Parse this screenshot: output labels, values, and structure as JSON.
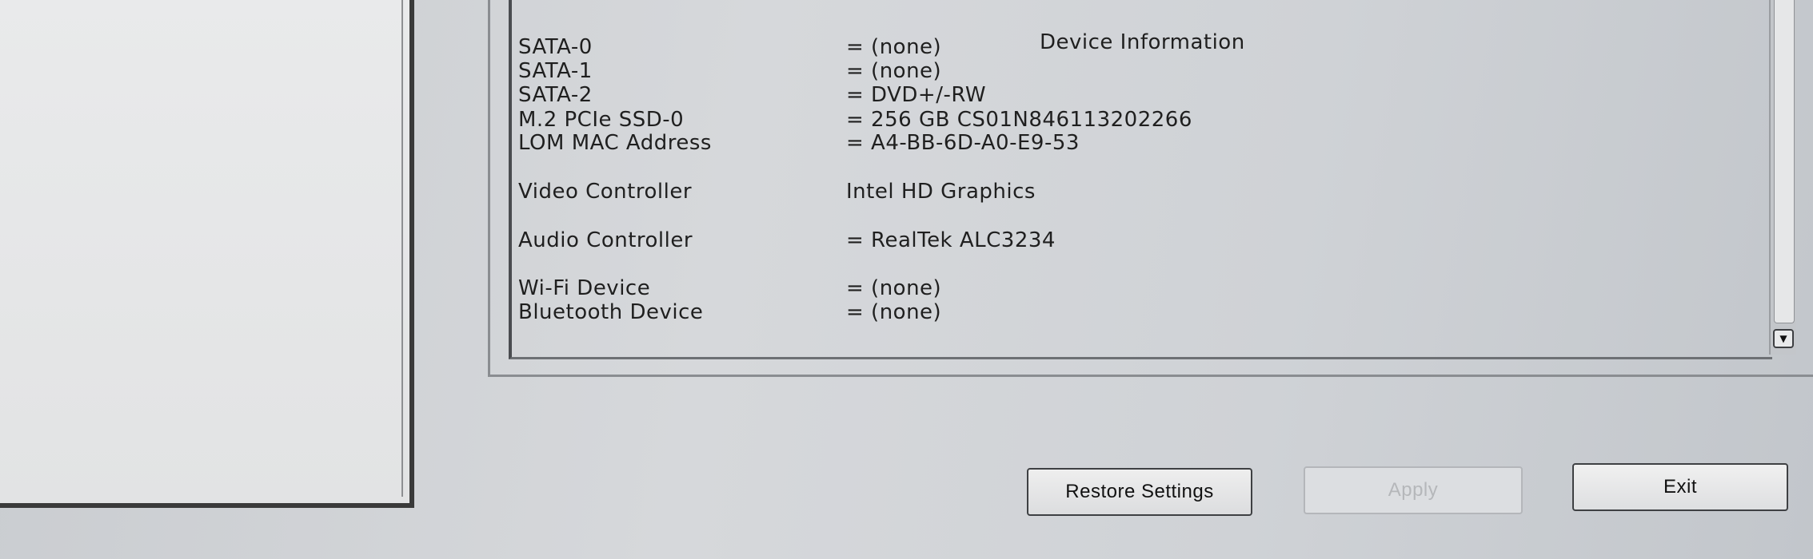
{
  "device_info": {
    "heading": "Device Information",
    "rows": [
      {
        "label": "SATA-0",
        "value": "= (none)"
      },
      {
        "label": "SATA-1",
        "value": "= (none)"
      },
      {
        "label": "SATA-2",
        "value": "= DVD+/-RW"
      },
      {
        "label": "M.2 PCIe SSD-0",
        "value": "= 256 GB CS01N846113202266"
      },
      {
        "label": "LOM MAC Address",
        "value": "= A4-BB-6D-A0-E9-53"
      },
      {
        "label": "Video Controller",
        "value": "Intel HD Graphics"
      },
      {
        "label": "Audio Controller",
        "value": "= RealTek ALC3234"
      },
      {
        "label": "Wi-Fi Device",
        "value": "= (none)"
      },
      {
        "label": "Bluetooth Device",
        "value": "= (none)"
      }
    ]
  },
  "buttons": {
    "restore_label": "Restore Settings",
    "apply_label": "Apply",
    "exit_label": "Exit"
  },
  "icons": {
    "scroll_down": "chevron-down-icon"
  }
}
